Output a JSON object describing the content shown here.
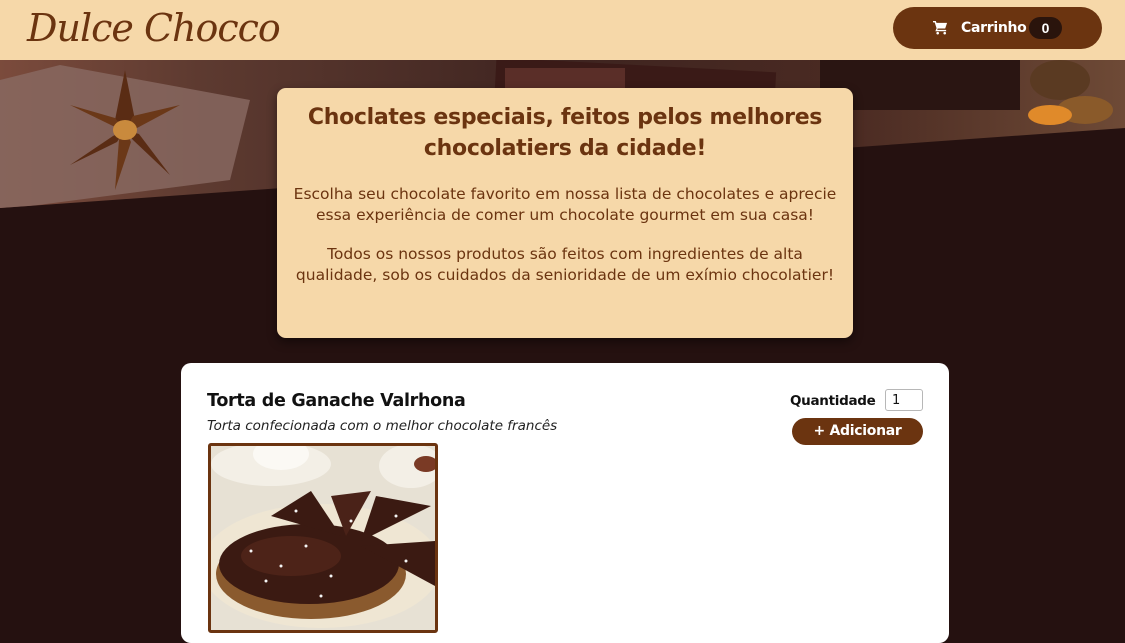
{
  "header": {
    "brand": "Dulce Chocco",
    "cart": {
      "label": "Carrinho",
      "count": "0",
      "icon": "cart-icon"
    }
  },
  "intro": {
    "title": "Choclates especiais, feitos pelos melhores chocolatiers da cidade!",
    "paragraph_1": "Escolha seu chocolate favorito em nossa lista de chocolates e aprecie essa experiência de comer um chocolate gourmet em sua casa!",
    "paragraph_2": "Todos os nossos produtos são feitos com ingredientes de alta qualidade, sob os cuidados da senioridade de um exímio chocolatier!"
  },
  "products": [
    {
      "name": "Torta de Ganache Valrhona",
      "description": "Torta confecionada com o melhor chocolate francês",
      "quantity_label": "Quantidade",
      "quantity_value": "1",
      "add_label": "+ Adicionar"
    }
  ],
  "colors": {
    "header_bg": "#f6d8a9",
    "brand_brown": "#6b3410",
    "page_bg": "#251110",
    "card_bg": "#ffffff"
  }
}
